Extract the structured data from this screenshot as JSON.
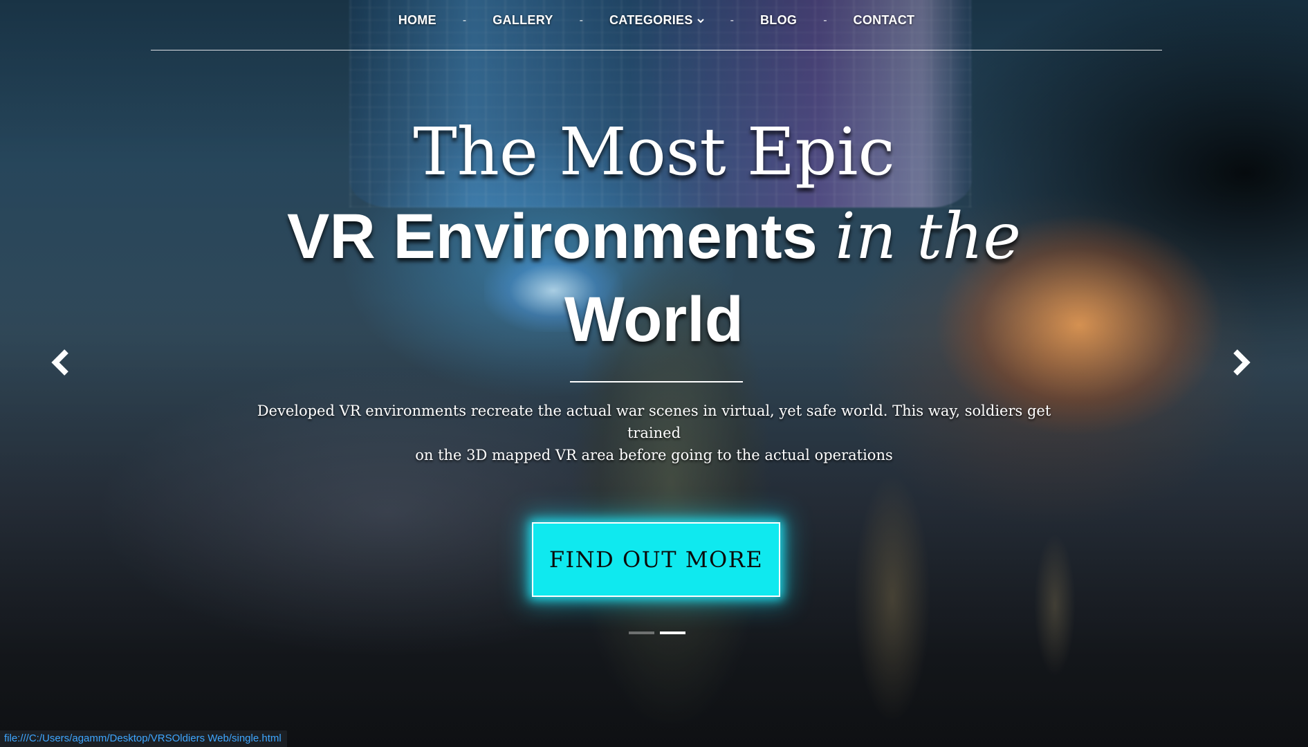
{
  "nav": {
    "items": [
      {
        "label": "HOME"
      },
      {
        "label": "GALLERY"
      },
      {
        "label": "CATEGORIES",
        "has_dropdown": true
      },
      {
        "label": "BLOG"
      },
      {
        "label": "CONTACT"
      }
    ],
    "separator": "-"
  },
  "hero": {
    "title_line1": "The Most Epic",
    "title_line2_bold": "VR Environments",
    "title_line2_italic": "in the",
    "title_line3": "World",
    "subtitle_line1": "Developed VR environments recreate the actual war scenes in virtual, yet safe world. This way, soldiers get trained",
    "subtitle_line2": "on the 3D mapped VR area before going to the actual operations",
    "cta_label": "FIND OUT MORE",
    "cta_color": "#0fe9ef"
  },
  "carousel": {
    "prev_icon": "chevron-left-icon",
    "next_icon": "chevron-right-icon",
    "slides_count": 2,
    "active_slide": 2
  },
  "statusbar": {
    "url": "file:///C:/Users/agamm/Desktop/VRSOldiers Web/single.html"
  }
}
